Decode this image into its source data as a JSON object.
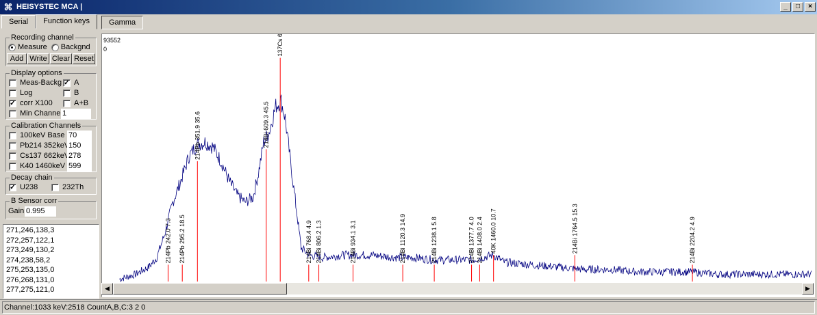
{
  "window": {
    "title": "HEISYSTEC MCA |",
    "minimize_label": "_",
    "maximize_label": "□",
    "close_label": "×"
  },
  "tabs": [
    {
      "label": "Serial",
      "active": false
    },
    {
      "label": "Function keys",
      "active": true
    }
  ],
  "chart_tabs": [
    {
      "label": "Gamma",
      "active": true
    }
  ],
  "recording": {
    "title": "Recording channel",
    "measure_label": "Measure",
    "measure_selected": true,
    "background_label": "Backgnd",
    "background_selected": false,
    "buttons": [
      "Add",
      "Write",
      "Clear",
      "Reset"
    ]
  },
  "display": {
    "title": "Display options",
    "meas_backg": {
      "label": "Meas-Backg",
      "checked": false
    },
    "a": {
      "label": "A",
      "checked": true
    },
    "log": {
      "label": "Log",
      "checked": false
    },
    "b": {
      "label": "B",
      "checked": false
    },
    "corr": {
      "label": "corr X100",
      "checked": true
    },
    "apb": {
      "label": "A+B",
      "checked": false
    },
    "min_channel": {
      "label": "Min Channel",
      "checked": false,
      "value": "1"
    }
  },
  "calibration": {
    "title": "Calibration   Channels",
    "rows": [
      {
        "label": "100keV Base",
        "value": "70",
        "checked": false
      },
      {
        "label": "Pb214 352keV",
        "value": "150",
        "checked": false
      },
      {
        "label": "Cs137 662keV",
        "value": "278",
        "checked": false
      },
      {
        "label": "K40 1460keV",
        "value": "599",
        "checked": false
      }
    ]
  },
  "decay": {
    "title": "Decay chain",
    "u238": {
      "label": "U238",
      "checked": true
    },
    "th232": {
      "label": "232Th",
      "checked": false
    }
  },
  "sensor": {
    "title": "B Sensor corr",
    "gain_label": "Gain",
    "gain_value": "0.995"
  },
  "memo_lines": [
    "271,246,138,3",
    "272,257,122,1",
    "273,249,130,2",
    "274,238,58,2",
    "275,253,135,0",
    "276,268,131,0",
    "277,275,121,0"
  ],
  "status": "Channel:1033 keV:2518 CountA,B,C:3 2 0",
  "colors": {
    "spectrum": "#000080",
    "marker": "#ff0000",
    "titlebar_start": "#0a246a"
  },
  "chart_data": {
    "type": "line",
    "ymax_label": "93552",
    "ymin_label": "0",
    "xmax_kev": 2650,
    "ymax_frac": 1.0,
    "spectrum_envelope": [
      [
        0,
        0.0
      ],
      [
        60,
        0.01
      ],
      [
        120,
        0.03
      ],
      [
        170,
        0.06
      ],
      [
        200,
        0.1
      ],
      [
        230,
        0.2
      ],
      [
        260,
        0.33
      ],
      [
        290,
        0.42
      ],
      [
        320,
        0.52
      ],
      [
        350,
        0.57
      ],
      [
        380,
        0.58
      ],
      [
        410,
        0.56
      ],
      [
        440,
        0.5
      ],
      [
        470,
        0.42
      ],
      [
        500,
        0.36
      ],
      [
        530,
        0.33
      ],
      [
        560,
        0.35
      ],
      [
        580,
        0.45
      ],
      [
        600,
        0.58
      ],
      [
        620,
        0.62
      ],
      [
        645,
        0.73
      ],
      [
        665,
        0.75
      ],
      [
        680,
        0.68
      ],
      [
        700,
        0.5
      ],
      [
        720,
        0.32
      ],
      [
        740,
        0.14
      ],
      [
        770,
        0.11
      ],
      [
        820,
        0.1
      ],
      [
        900,
        0.11
      ],
      [
        1000,
        0.11
      ],
      [
        1100,
        0.1
      ],
      [
        1150,
        0.1
      ],
      [
        1240,
        0.09
      ],
      [
        1300,
        0.09
      ],
      [
        1380,
        0.09
      ],
      [
        1460,
        0.11
      ],
      [
        1500,
        0.08
      ],
      [
        1600,
        0.07
      ],
      [
        1700,
        0.06
      ],
      [
        1800,
        0.05
      ],
      [
        1900,
        0.05
      ],
      [
        2000,
        0.04
      ],
      [
        2100,
        0.04
      ],
      [
        2200,
        0.04
      ],
      [
        2300,
        0.03
      ],
      [
        2400,
        0.03
      ],
      [
        2500,
        0.03
      ],
      [
        2600,
        0.03
      ]
    ],
    "markers": [
      {
        "label": "214Pb 242.0",
        "kev": 242.0,
        "intensity": "7.3",
        "level": 0.07
      },
      {
        "label": "214Pb 295.2",
        "kev": 295.2,
        "intensity": "18.5",
        "level": 0.07
      },
      {
        "label": "214Pb 351.9",
        "kev": 351.9,
        "intensity": "35.6",
        "level": 0.5
      },
      {
        "label": "214Bi 609.3",
        "kev": 609.3,
        "intensity": "45.5",
        "level": 0.55
      },
      {
        "label": "137Cs 661.7",
        "kev": 661.7,
        "intensity": "",
        "level": 0.93
      },
      {
        "label": "214Bi 768.4",
        "kev": 768.4,
        "intensity": "4.9",
        "level": 0.07
      },
      {
        "label": "214Bi 806.2",
        "kev": 806.2,
        "intensity": "1.3",
        "level": 0.07
      },
      {
        "label": "214Bi 934.1",
        "kev": 934.1,
        "intensity": "3.1",
        "level": 0.07
      },
      {
        "label": "214Bi 1120.3",
        "kev": 1120.3,
        "intensity": "14.9",
        "level": 0.07
      },
      {
        "label": "214Bi 1238.1",
        "kev": 1238.1,
        "intensity": "5.8",
        "level": 0.07
      },
      {
        "label": "214Bi 1377.7",
        "kev": 1377.7,
        "intensity": "4.0",
        "level": 0.07
      },
      {
        "label": "214Bi 1408.0",
        "kev": 1408.0,
        "intensity": "2.4",
        "level": 0.07
      },
      {
        "label": "40K 1460.0",
        "kev": 1460.0,
        "intensity": "10.7",
        "level": 0.11
      },
      {
        "label": "214Bi 1764.5",
        "kev": 1764.5,
        "intensity": "15.3",
        "level": 0.11
      },
      {
        "label": "214Bi 2204.2",
        "kev": 2204.2,
        "intensity": "4.9",
        "level": 0.07
      }
    ]
  }
}
